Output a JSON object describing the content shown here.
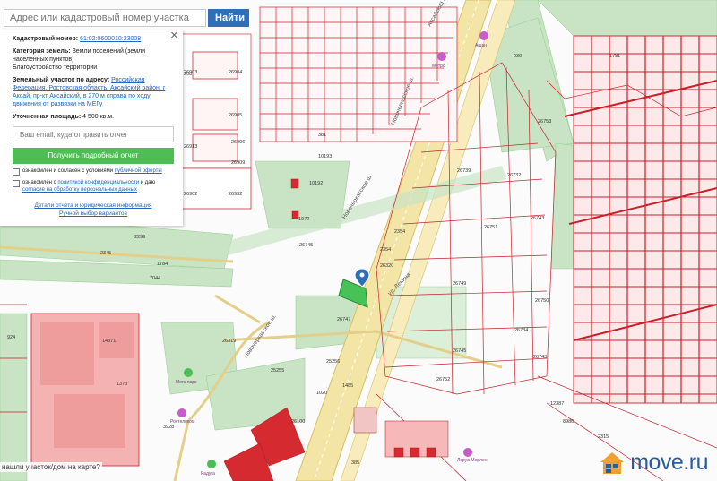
{
  "search": {
    "placeholder": "Адрес или кадастровый номер участка",
    "button_label": "Найти"
  },
  "panel": {
    "cadastral_label": "Кадастровый номер:",
    "cadastral_value": "61:02:0600010:23008",
    "category_label": "Категория земель:",
    "category_value": "Земли поселений (земли населенных пунктов)",
    "use_value": "Благоустройство территории",
    "address_label": "Земельный участок по адресу:",
    "address_value": "Российская Федерация, Ростовская область, Аксайский район, г Аксай, пр-кт Аксайский, в 270 м справа по ходу движения от развязки на МЕГу",
    "area_label": "Уточненная площадь:",
    "area_value": "4 500 кв.м.",
    "email_placeholder": "Ваш email, куда отправить отчет",
    "report_button": "Получить подробный отчет",
    "consent1_prefix": "ознакомлен и согласен с условиями ",
    "consent1_link": "публичной оферты",
    "consent2_prefix": "ознакомлен с ",
    "consent2_link1": "политикой конфиденциальности",
    "consent2_mid": " и даю ",
    "consent2_link2": "согласие на обработку персональных данных",
    "details_link": "Детали отчета и юридическая информация",
    "manual_link": "Ручной выбор вариантов"
  },
  "bottom_hint": "нашли участок/дом на карте?",
  "brand": {
    "name": "move.ru",
    "color": "#2a5b9c"
  },
  "colors": {
    "parcel_stroke": "#c8202a",
    "greenbelt": "#c7e3c4",
    "road": "#f2dc8c",
    "building": "#d42a2f"
  },
  "map_labels": {
    "parcels": [
      "26903",
      "26904",
      "26905",
      "26906",
      "26909",
      "26913",
      "26902",
      "26932",
      "208",
      "381",
      "10193",
      "10192",
      "1072",
      "2299",
      "2345",
      "1784",
      "7044",
      "26745",
      "26747",
      "26745",
      "26752",
      "26734",
      "26743",
      "26743",
      "26750",
      "26751",
      "26749",
      "26739",
      "26732",
      "26753",
      "939",
      "2354",
      "2354",
      "26320",
      "26319",
      "25255",
      "25256",
      "1485",
      "1020",
      "26100",
      "385",
      "1781",
      "12387",
      "2315",
      "8986",
      "14871",
      "1373",
      "924",
      "3928"
    ],
    "streets": [
      "Новочеркасское ш.",
      "Новочеркасское ш.",
      "Новочеркасское ш.",
      "Аксайский пр-кт",
      "ул. Ленина"
    ],
    "poi": [
      "Мега парк",
      "Ашан",
      "Метро",
      "Ростелеком",
      "Радуга",
      "Леруа Мерлен"
    ]
  }
}
